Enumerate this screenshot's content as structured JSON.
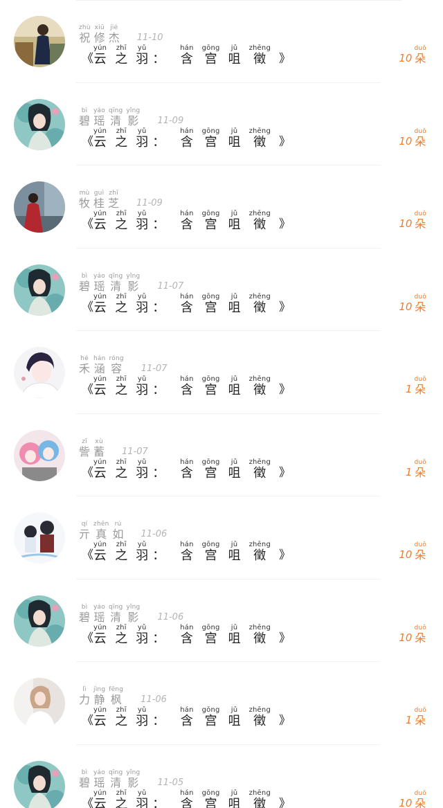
{
  "title": {
    "open_bracket": "《",
    "close_bracket": "》",
    "colon": "：",
    "words": [
      {
        "py": "yún",
        "hz": "云"
      },
      {
        "py": "zhī",
        "hz": "之"
      },
      {
        "py": "yǔ",
        "hz": "羽"
      },
      {
        "py": "hán",
        "hz": "含"
      },
      {
        "py": "gōng",
        "hz": "宫"
      },
      {
        "py": "jǔ",
        "hz": "咀"
      },
      {
        "py": "zhēng",
        "hz": "徵"
      }
    ]
  },
  "unit": {
    "py": "duǒ",
    "hz": "朵"
  },
  "colors": {
    "accent": "#f07b2a",
    "meta": "#9a9a9a",
    "divider": "#f2f2f2"
  },
  "records": [
    {
      "name": [
        {
          "py": "zhù",
          "hz": "祝"
        },
        {
          "py": "xiū",
          "hz": "修"
        },
        {
          "py": "jié",
          "hz": "杰"
        }
      ],
      "date": "11-10",
      "count": "10",
      "avatar": "avatar-qipao"
    },
    {
      "name": [
        {
          "py": "bì",
          "hz": "碧"
        },
        {
          "py": "yáo",
          "hz": "瑶"
        },
        {
          "py": "qīng",
          "hz": "清"
        },
        {
          "py": "yǐng",
          "hz": "影"
        }
      ],
      "date": "11-09",
      "count": "10",
      "avatar": "avatar-painted-lady"
    },
    {
      "name": [
        {
          "py": "mù",
          "hz": "牧"
        },
        {
          "py": "guì",
          "hz": "桂"
        },
        {
          "py": "zhī",
          "hz": "芝"
        }
      ],
      "date": "11-09",
      "count": "10",
      "avatar": "avatar-red-robe"
    },
    {
      "name": [
        {
          "py": "bì",
          "hz": "碧"
        },
        {
          "py": "yáo",
          "hz": "瑶"
        },
        {
          "py": "qīng",
          "hz": "清"
        },
        {
          "py": "yǐng",
          "hz": "影"
        }
      ],
      "date": "11-07",
      "count": "10",
      "avatar": "avatar-painted-lady"
    },
    {
      "name": [
        {
          "py": "hé",
          "hz": "禾"
        },
        {
          "py": "hán",
          "hz": "涵"
        },
        {
          "py": "róng",
          "hz": "容"
        }
      ],
      "date": "11-07",
      "count": "1",
      "avatar": "avatar-anime-boy"
    },
    {
      "name": [
        {
          "py": "zǐ",
          "hz": "訾"
        },
        {
          "py": "xù",
          "hz": "蓄"
        }
      ],
      "date": "11-07",
      "count": "1",
      "avatar": "avatar-anime-girls"
    },
    {
      "name": [
        {
          "py": "qí",
          "hz": "亓"
        },
        {
          "py": "zhēn",
          "hz": "真"
        },
        {
          "py": "rú",
          "hz": "如"
        }
      ],
      "date": "11-06",
      "count": "10",
      "avatar": "avatar-chibi-pair"
    },
    {
      "name": [
        {
          "py": "bì",
          "hz": "碧"
        },
        {
          "py": "yáo",
          "hz": "瑶"
        },
        {
          "py": "qīng",
          "hz": "清"
        },
        {
          "py": "yǐng",
          "hz": "影"
        }
      ],
      "date": "11-06",
      "count": "10",
      "avatar": "avatar-painted-lady"
    },
    {
      "name": [
        {
          "py": "lì",
          "hz": "力"
        },
        {
          "py": "jìng",
          "hz": "静"
        },
        {
          "py": "fēng",
          "hz": "枫"
        }
      ],
      "date": "11-06",
      "count": "1",
      "avatar": "avatar-photo-girl"
    },
    {
      "name": [
        {
          "py": "bì",
          "hz": "碧"
        },
        {
          "py": "yáo",
          "hz": "瑶"
        },
        {
          "py": "qīng",
          "hz": "清"
        },
        {
          "py": "yǐng",
          "hz": "影"
        }
      ],
      "date": "11-05",
      "count": "10",
      "avatar": "avatar-painted-lady"
    }
  ]
}
